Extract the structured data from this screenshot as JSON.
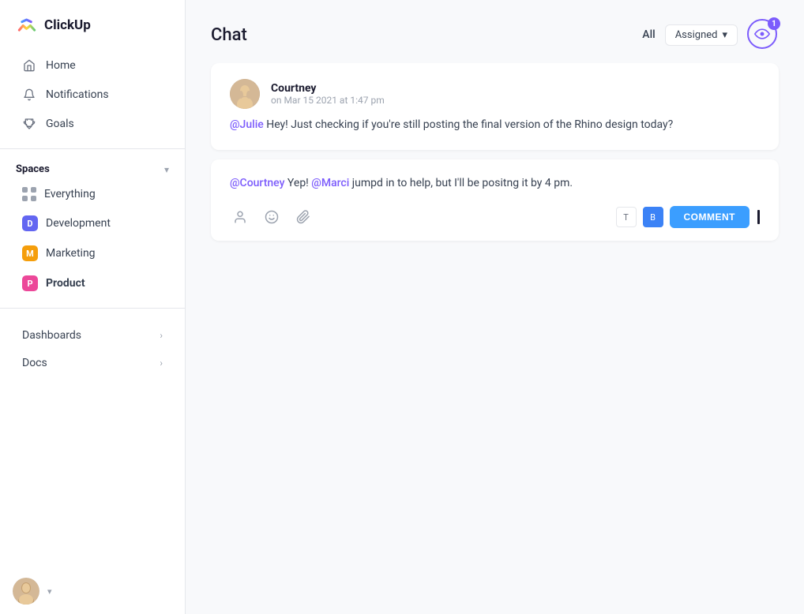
{
  "app": {
    "name": "ClickUp"
  },
  "sidebar": {
    "nav_items": [
      {
        "id": "home",
        "label": "Home",
        "icon": "home"
      },
      {
        "id": "notifications",
        "label": "Notifications",
        "icon": "bell"
      },
      {
        "id": "goals",
        "label": "Goals",
        "icon": "trophy"
      }
    ],
    "spaces": {
      "label": "Spaces",
      "items": [
        {
          "id": "everything",
          "label": "Everything",
          "type": "dots"
        },
        {
          "id": "development",
          "label": "Development",
          "type": "badge",
          "color": "#6366f1",
          "letter": "D"
        },
        {
          "id": "marketing",
          "label": "Marketing",
          "type": "badge",
          "color": "#f59e0b",
          "letter": "M"
        },
        {
          "id": "product",
          "label": "Product",
          "type": "badge",
          "color": "#ec4899",
          "letter": "P",
          "active": true
        }
      ]
    },
    "expandables": [
      {
        "id": "dashboards",
        "label": "Dashboards"
      },
      {
        "id": "docs",
        "label": "Docs"
      }
    ]
  },
  "chat": {
    "title": "Chat",
    "filter_all": "All",
    "filter_assigned": "Assigned",
    "notification_count": "1",
    "messages": [
      {
        "id": "msg1",
        "author": "Courtney",
        "timestamp": "on Mar 15 2021 at 1:47 pm",
        "mention": "@Julie",
        "body": " Hey! Just checking if you're still posting the final version of the Rhino design today?"
      }
    ],
    "reply": {
      "mention1": "@Courtney",
      "text1": " Yep! ",
      "mention2": "@Marci",
      "text2": " jumpd in to help, but I'll be positng it by 4 pm."
    },
    "comment_button": "COMMENT"
  }
}
